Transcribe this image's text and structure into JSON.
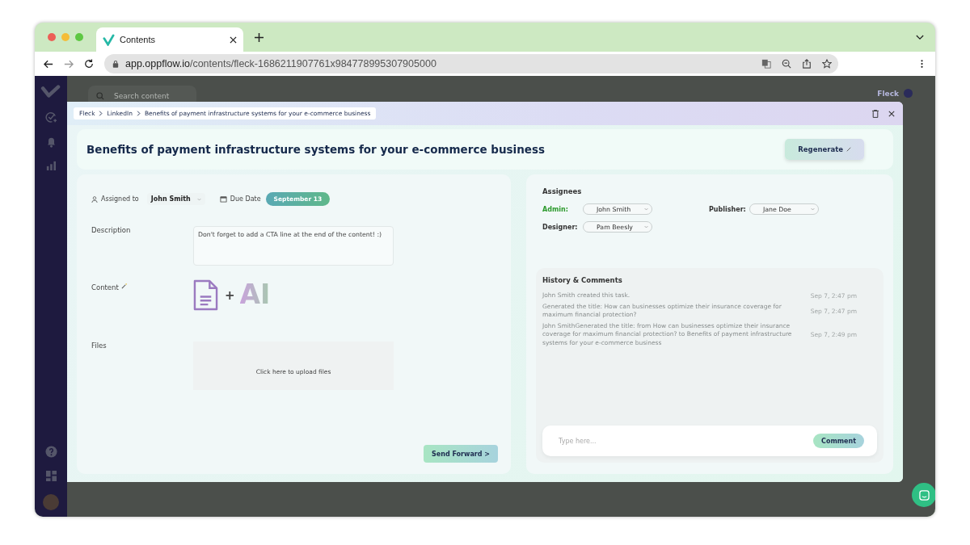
{
  "browser": {
    "tab_title": "Contents",
    "url_host": "app.oppflow.io",
    "url_path": "/contents/fleck-1686211907761x984778995307905000"
  },
  "app": {
    "search_placeholder": "Search content",
    "user": "Fleck"
  },
  "modal": {
    "breadcrumb": [
      "Fleck",
      "LinkedIn",
      "Benefits of payment infrastructure systems for your e-commerce business"
    ],
    "title": "Benefits of payment infrastructure systems for your e-commerce business",
    "regenerate_button": "Regenerate"
  },
  "task": {
    "assigned_label": "Assigned to",
    "assignee": "John Smith",
    "due_label": "Due Date",
    "due_date": "September 13",
    "description_label": "Description",
    "description": "Don't forget to add a CTA line at the end of the content! :)",
    "content_label": "Content",
    "content_plus": "+",
    "content_ai": "AI",
    "files_label": "Files",
    "upload_text": "Click here to upload files",
    "send_button": "Send Forward >"
  },
  "assignees": {
    "heading": "Assignees",
    "roles": [
      {
        "role": "Admin:",
        "name": "John Smith",
        "highlighted": true
      },
      {
        "role": "Publisher:",
        "name": "Jane Doe",
        "highlighted": false
      },
      {
        "role": "Designer:",
        "name": "Pam Beesly",
        "highlighted": false
      }
    ]
  },
  "history": {
    "heading": "History & Comments",
    "entries": [
      {
        "text": "John Smith created this task.",
        "time": "Sep 7, 2:47 pm"
      },
      {
        "text": "Generated the title: How can businesses optimize their insurance coverage for maximum financial protection?",
        "time": "Sep 7, 2:47 pm"
      },
      {
        "text": "John SmithGenerated the title:  from How can businesses optimize their insurance coverage for maximum financial protection? to Benefits of payment infrastructure systems for your e-commerce business",
        "time": "Sep 7, 2:49 pm"
      }
    ],
    "comment_placeholder": "Type here...",
    "comment_button": "Comment"
  }
}
